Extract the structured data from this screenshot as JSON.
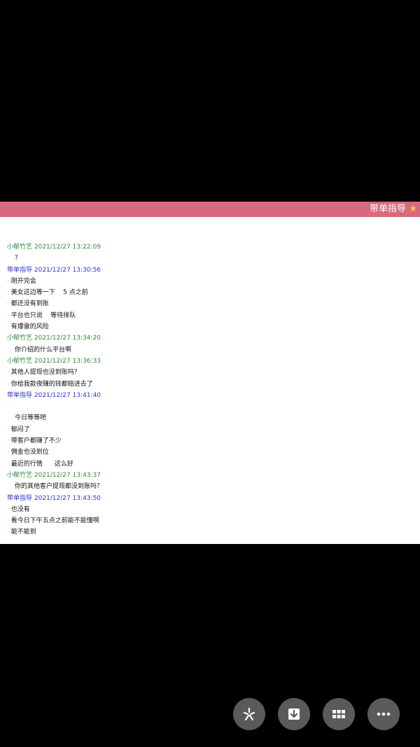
{
  "header": {
    "title": "带单指导",
    "star_icon": "star-icon"
  },
  "messages": [
    {
      "type": "header",
      "color": "green",
      "text": "小郁竹艺 2021/12/27 13:22:09"
    },
    {
      "type": "plain",
      "text": "？"
    },
    {
      "type": "header",
      "color": "blue",
      "text": "带单指导 2021/12/27 13:30:56"
    },
    {
      "type": "bullet",
      "text": "刚开完会"
    },
    {
      "type": "bullet",
      "text": "美女这边等一下    5 点之前"
    },
    {
      "type": "bullet",
      "text": "都还没有到账"
    },
    {
      "type": "bullet",
      "text": "平台也只说    等待排队"
    },
    {
      "type": "bullet",
      "text": "有爆雷的风险"
    },
    {
      "type": "header",
      "color": "green",
      "text": "小郁竹艺 2021/12/27 13:34:20"
    },
    {
      "type": "plain",
      "text": "你介绍的什么平台啊"
    },
    {
      "type": "header",
      "color": "green",
      "text": "小郁竹艺 2021/12/27 13:36:33"
    },
    {
      "type": "bullet",
      "text": "其他人提现也没到账吗？"
    },
    {
      "type": "bullet",
      "text": "你给我款夜赚的钱都赔进去了"
    },
    {
      "type": "header",
      "color": "blue",
      "text": "带单指导 2021/12/27 13:41:40"
    },
    {
      "type": "bullet",
      "text": ""
    },
    {
      "type": "plain",
      "text": "今日等等吧"
    },
    {
      "type": "bullet",
      "text": "郁闷了"
    },
    {
      "type": "bullet",
      "text": "带客户都赚了不少"
    },
    {
      "type": "bullet",
      "text": "佣金也没到位"
    },
    {
      "type": "bullet",
      "text": "最近的行情      这么好"
    },
    {
      "type": "header",
      "color": "green",
      "text": "小郁竹艺 2021/12/27 13:43:37"
    },
    {
      "type": "plain",
      "text": "你的其他客户提现都没到账吗？"
    },
    {
      "type": "header",
      "color": "blue",
      "text": "带单指导 2021/12/27 13:43:50"
    },
    {
      "type": "bullet",
      "text": "也没有"
    },
    {
      "type": "bullet",
      "text": "看今日下午五点之前能不能懂啊"
    },
    {
      "type": "bullet",
      "text": "能不能到"
    }
  ],
  "controls": [
    {
      "name": "pinwheel-button",
      "icon": "pinwheel-icon"
    },
    {
      "name": "download-button",
      "icon": "download-icon"
    },
    {
      "name": "grid-button",
      "icon": "grid-icon"
    },
    {
      "name": "more-button",
      "icon": "more-dots-icon"
    }
  ]
}
